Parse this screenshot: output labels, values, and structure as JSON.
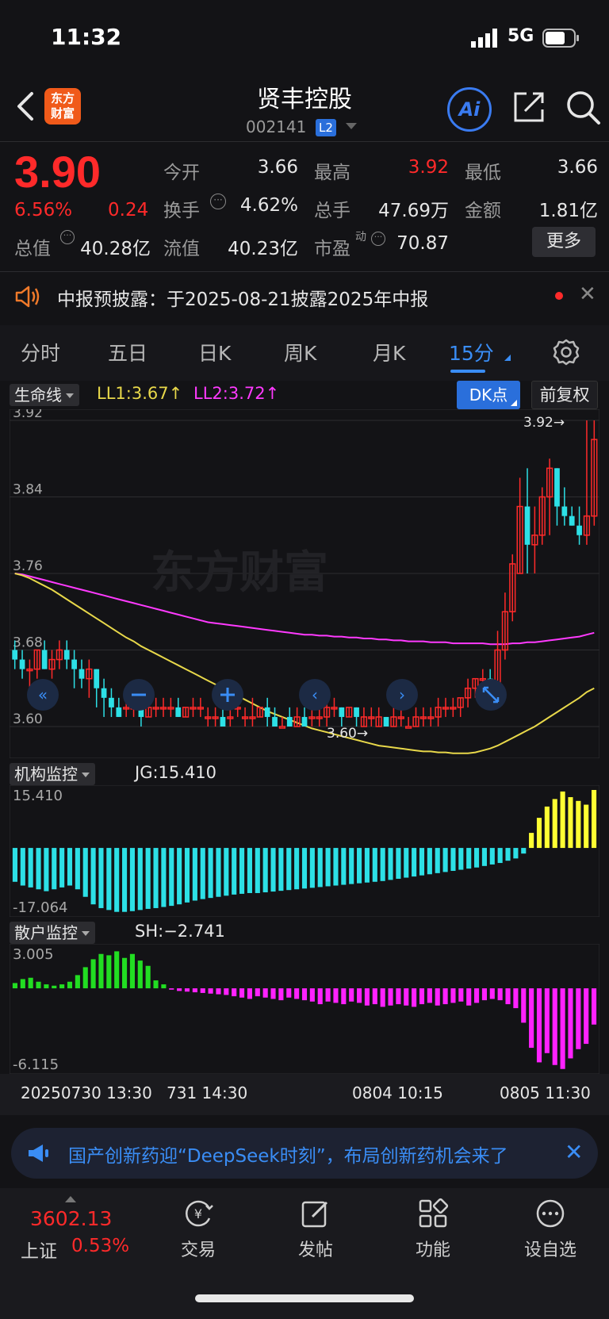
{
  "status": {
    "time": "11:32",
    "network": "5G"
  },
  "header": {
    "logo": "东方\n财富",
    "name": "贤丰控股",
    "code": "002141",
    "level": "L2",
    "ai": "Ai"
  },
  "quote": {
    "price": "3.90",
    "pct": "6.56%",
    "change": "0.24",
    "open_label": "今开",
    "open": "3.66",
    "high_label": "最高",
    "high": "3.92",
    "low_label": "最低",
    "low": "3.66",
    "turnover_label": "换手",
    "turnover": "4.62%",
    "volume_label": "总手",
    "volume": "47.69万",
    "amount_label": "金额",
    "amount": "1.81亿",
    "mktcap_label": "总值",
    "mktcap": "40.28亿",
    "float_label": "流值",
    "float": "40.23亿",
    "pe_label": "市盈",
    "pe_sup": "动",
    "pe": "70.87",
    "more": "更多"
  },
  "notice": {
    "text": "中报预披露：于2025-08-21披露2025年中报"
  },
  "tabs": [
    "分时",
    "五日",
    "日K",
    "周K",
    "月K",
    "15分"
  ],
  "indicators": {
    "main": {
      "name": "生命线",
      "ll1": "LL1:3.67↑",
      "ll2": "LL2:3.72↑",
      "dk": "DK点",
      "adjust": "前复权"
    },
    "jg": {
      "name": "机构监控",
      "value": "JG:15.410"
    },
    "sh": {
      "name": "散户监控",
      "value": "SH:−2.741"
    }
  },
  "colors": {
    "up": "#ff2a2a",
    "down": "#2de0e6",
    "ll1": "#e8d84a",
    "ll2": "#ff3aff",
    "accent": "#3a8df5",
    "jg_pos": "#ffff33",
    "sh_pos": "#22dd22",
    "sh_neg": "#ff22ff"
  },
  "chart_data": [
    {
      "type": "candlestick",
      "title": "生命线",
      "ylim": [
        3.6,
        3.92
      ],
      "y_ticks": [
        "3.92",
        "3.84",
        "3.76",
        "3.68",
        "3.60"
      ],
      "watermark": "东方财富",
      "high_marker": "3.92→",
      "low_marker": "3.60→",
      "candles": [
        [
          3.68,
          3.67,
          3.69,
          3.66
        ],
        [
          3.67,
          3.66,
          3.68,
          3.65
        ],
        [
          3.66,
          3.66,
          3.67,
          3.64
        ],
        [
          3.66,
          3.68,
          3.68,
          3.65
        ],
        [
          3.68,
          3.66,
          3.69,
          3.66
        ],
        [
          3.66,
          3.67,
          3.68,
          3.65
        ],
        [
          3.67,
          3.68,
          3.69,
          3.66
        ],
        [
          3.68,
          3.67,
          3.69,
          3.66
        ],
        [
          3.67,
          3.66,
          3.68,
          3.64
        ],
        [
          3.66,
          3.65,
          3.67,
          3.64
        ],
        [
          3.65,
          3.66,
          3.67,
          3.63
        ],
        [
          3.66,
          3.64,
          3.66,
          3.62
        ],
        [
          3.64,
          3.63,
          3.65,
          3.61
        ],
        [
          3.63,
          3.62,
          3.64,
          3.61
        ],
        [
          3.62,
          3.61,
          3.63,
          3.61
        ],
        [
          3.62,
          3.62,
          3.63,
          3.61
        ],
        [
          3.62,
          3.62,
          3.63,
          3.61
        ],
        [
          3.62,
          3.61,
          3.63,
          3.6
        ],
        [
          3.61,
          3.62,
          3.62,
          3.61
        ],
        [
          3.62,
          3.62,
          3.63,
          3.61
        ],
        [
          3.62,
          3.62,
          3.63,
          3.61
        ],
        [
          3.62,
          3.62,
          3.63,
          3.61
        ],
        [
          3.62,
          3.61,
          3.63,
          3.61
        ],
        [
          3.61,
          3.62,
          3.62,
          3.61
        ],
        [
          3.62,
          3.62,
          3.63,
          3.61
        ],
        [
          3.62,
          3.62,
          3.63,
          3.61
        ],
        [
          3.61,
          3.61,
          3.62,
          3.6
        ],
        [
          3.61,
          3.61,
          3.62,
          3.6
        ],
        [
          3.61,
          3.6,
          3.62,
          3.6
        ],
        [
          3.61,
          3.61,
          3.62,
          3.6
        ],
        [
          3.62,
          3.62,
          3.63,
          3.61
        ],
        [
          3.61,
          3.61,
          3.62,
          3.6
        ],
        [
          3.61,
          3.61,
          3.63,
          3.6
        ],
        [
          3.61,
          3.62,
          3.62,
          3.61
        ],
        [
          3.62,
          3.61,
          3.63,
          3.6
        ],
        [
          3.61,
          3.6,
          3.62,
          3.6
        ],
        [
          3.6,
          3.6,
          3.61,
          3.6
        ],
        [
          3.61,
          3.6,
          3.62,
          3.6
        ],
        [
          3.6,
          3.61,
          3.62,
          3.6
        ],
        [
          3.61,
          3.6,
          3.62,
          3.6
        ],
        [
          3.61,
          3.61,
          3.62,
          3.6
        ],
        [
          3.61,
          3.61,
          3.62,
          3.6
        ],
        [
          3.61,
          3.62,
          3.63,
          3.6
        ],
        [
          3.62,
          3.62,
          3.63,
          3.61
        ],
        [
          3.62,
          3.61,
          3.62,
          3.6
        ],
        [
          3.61,
          3.62,
          3.62,
          3.61
        ],
        [
          3.62,
          3.61,
          3.62,
          3.6
        ],
        [
          3.6,
          3.61,
          3.62,
          3.6
        ],
        [
          3.61,
          3.61,
          3.62,
          3.6
        ],
        [
          3.6,
          3.61,
          3.62,
          3.6
        ],
        [
          3.61,
          3.6,
          3.61,
          3.6
        ],
        [
          3.6,
          3.61,
          3.62,
          3.6
        ],
        [
          3.61,
          3.61,
          3.62,
          3.6
        ],
        [
          3.6,
          3.6,
          3.61,
          3.6
        ],
        [
          3.6,
          3.61,
          3.62,
          3.6
        ],
        [
          3.61,
          3.61,
          3.62,
          3.6
        ],
        [
          3.61,
          3.61,
          3.62,
          3.6
        ],
        [
          3.61,
          3.62,
          3.63,
          3.6
        ],
        [
          3.62,
          3.62,
          3.63,
          3.61
        ],
        [
          3.62,
          3.62,
          3.63,
          3.61
        ],
        [
          3.62,
          3.63,
          3.63,
          3.61
        ],
        [
          3.63,
          3.64,
          3.65,
          3.62
        ],
        [
          3.64,
          3.65,
          3.65,
          3.63
        ],
        [
          3.65,
          3.65,
          3.66,
          3.63
        ],
        [
          3.65,
          3.64,
          3.66,
          3.64
        ],
        [
          3.64,
          3.68,
          3.7,
          3.64
        ],
        [
          3.68,
          3.72,
          3.74,
          3.67
        ],
        [
          3.72,
          3.77,
          3.78,
          3.71
        ],
        [
          3.76,
          3.83,
          3.86,
          3.76
        ],
        [
          3.83,
          3.79,
          3.87,
          3.76
        ],
        [
          3.79,
          3.8,
          3.83,
          3.76
        ],
        [
          3.8,
          3.84,
          3.85,
          3.79
        ],
        [
          3.84,
          3.87,
          3.88,
          3.8
        ],
        [
          3.87,
          3.83,
          3.87,
          3.81
        ],
        [
          3.83,
          3.82,
          3.85,
          3.81
        ],
        [
          3.82,
          3.81,
          3.83,
          3.81
        ],
        [
          3.81,
          3.8,
          3.83,
          3.79
        ],
        [
          3.8,
          3.82,
          3.92,
          3.79
        ],
        [
          3.82,
          3.9,
          3.92,
          3.81
        ]
      ],
      "ll1": [
        3.76,
        3.758,
        3.755,
        3.751,
        3.747,
        3.743,
        3.738,
        3.733,
        3.728,
        3.723,
        3.718,
        3.713,
        3.708,
        3.703,
        3.698,
        3.693,
        3.689,
        3.684,
        3.68,
        3.676,
        3.672,
        3.668,
        3.664,
        3.66,
        3.656,
        3.652,
        3.648,
        3.644,
        3.64,
        3.636,
        3.632,
        3.628,
        3.624,
        3.62,
        3.616,
        3.613,
        3.61,
        3.607,
        3.604,
        3.601,
        3.598,
        3.596,
        3.594,
        3.592,
        3.59,
        3.588,
        3.586,
        3.584,
        3.582,
        3.58,
        3.579,
        3.578,
        3.577,
        3.576,
        3.575,
        3.574,
        3.574,
        3.573,
        3.573,
        3.572,
        3.572,
        3.572,
        3.573,
        3.575,
        3.577,
        3.58,
        3.584,
        3.588,
        3.592,
        3.596,
        3.6,
        3.605,
        3.61,
        3.615,
        3.62,
        3.625,
        3.63,
        3.636,
        3.64
      ],
      "ll2": [
        3.76,
        3.759,
        3.757,
        3.755,
        3.753,
        3.751,
        3.749,
        3.747,
        3.745,
        3.743,
        3.741,
        3.739,
        3.737,
        3.735,
        3.733,
        3.731,
        3.729,
        3.727,
        3.725,
        3.723,
        3.721,
        3.719,
        3.717,
        3.715,
        3.713,
        3.711,
        3.709,
        3.708,
        3.707,
        3.706,
        3.705,
        3.704,
        3.703,
        3.702,
        3.701,
        3.7,
        3.699,
        3.698,
        3.697,
        3.696,
        3.696,
        3.695,
        3.695,
        3.694,
        3.694,
        3.693,
        3.693,
        3.692,
        3.692,
        3.691,
        3.691,
        3.69,
        3.69,
        3.689,
        3.689,
        3.689,
        3.688,
        3.688,
        3.688,
        3.687,
        3.687,
        3.687,
        3.687,
        3.687,
        3.686,
        3.686,
        3.686,
        3.687,
        3.687,
        3.688,
        3.688,
        3.689,
        3.69,
        3.691,
        3.692,
        3.693,
        3.694,
        3.696,
        3.698
      ]
    },
    {
      "type": "bar",
      "title": "机构监控",
      "ylim": [
        -17.064,
        15.41
      ],
      "y_ticks": [
        "15.410",
        "-17.064"
      ],
      "values": [
        -9,
        -10,
        -10.5,
        -11,
        -11.5,
        -11,
        -10.5,
        -10,
        -11,
        -13,
        -15,
        -16,
        -16.5,
        -17,
        -17,
        -16.8,
        -16.5,
        -16.2,
        -16,
        -15.7,
        -15.4,
        -15,
        -14.5,
        -14,
        -13.6,
        -13.3,
        -13,
        -12.7,
        -12.4,
        -12.2,
        -12,
        -12,
        -11.8,
        -11.6,
        -11.4,
        -11.2,
        -11,
        -10.8,
        -10.6,
        -10.4,
        -10.2,
        -10,
        -9.8,
        -9.6,
        -9.4,
        -9.2,
        -9,
        -8.8,
        -8.5,
        -8.2,
        -7.9,
        -7.6,
        -7.3,
        -7,
        -6.7,
        -6.4,
        -6.1,
        -5.8,
        -5.5,
        -5.2,
        -4.8,
        -4.4,
        -4,
        -3.4,
        -2.8,
        -1.5,
        4,
        8,
        11,
        13,
        15,
        13.5,
        12.5,
        11.5,
        15.41
      ]
    },
    {
      "type": "bar",
      "title": "散户监控",
      "ylim": [
        -6.115,
        3.005
      ],
      "y_ticks": [
        "3.005",
        "-6.115"
      ],
      "values": [
        0.4,
        0.7,
        0.8,
        0.5,
        0.3,
        0.2,
        0.3,
        0.5,
        1.0,
        1.6,
        2.2,
        2.6,
        2.5,
        2.8,
        2.3,
        2.6,
        2.1,
        1.7,
        0.6,
        0.3,
        -0.1,
        -0.2,
        -0.25,
        -0.3,
        -0.35,
        -0.4,
        -0.45,
        -0.5,
        -0.6,
        -0.7,
        -0.8,
        -0.6,
        -0.7,
        -0.8,
        -0.9,
        -0.7,
        -0.8,
        -0.9,
        -1.0,
        -1.2,
        -1.0,
        -1.1,
        -1.2,
        -1.0,
        -1.1,
        -1.3,
        -1.2,
        -1.4,
        -1.3,
        -1.2,
        -1.3,
        -1.4,
        -1.2,
        -1.1,
        -1.3,
        -1.2,
        -1.1,
        -1.0,
        -1.3,
        -1.1,
        -0.9,
        -0.8,
        -0.9,
        -1.2,
        -1.5,
        -2.6,
        -4.5,
        -5.6,
        -4.9,
        -5.8,
        -6.1,
        -5.3,
        -4.6,
        -4.2,
        -2.741
      ]
    }
  ],
  "time_axis": [
    "20250730 13:30",
    "731 14:30",
    "0804 10:15",
    "0805 11:30"
  ],
  "news": {
    "text": "国产创新药迎“DeepSeek时刻”，布局创新药机会来了"
  },
  "bottom": {
    "index_value": "3602.13",
    "index_name": "上证",
    "index_pct": "0.53%",
    "nav": [
      "交易",
      "发帖",
      "功能",
      "设自选"
    ]
  }
}
